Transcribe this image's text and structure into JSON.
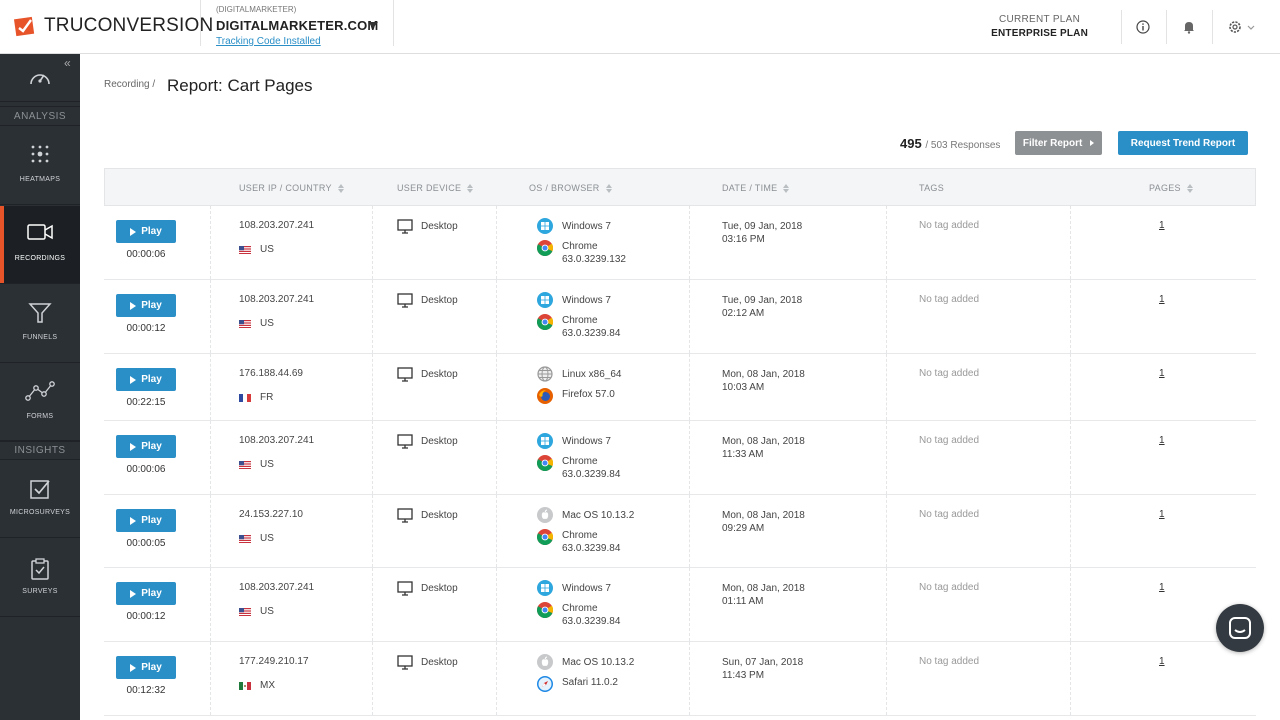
{
  "header": {
    "logo_text": "TRUCONVERSION",
    "account_small": "(DIGITALMARKETER)",
    "account_name": "DIGITALMARKETER.COM",
    "tracking_link": "Tracking Code Installed",
    "plan_label": "CURRENT PLAN",
    "plan_value": "ENTERPRISE PLAN"
  },
  "sidebar": {
    "collapse": "«",
    "section_analysis": "ANALYSIS",
    "section_insights": "INSIGHTS",
    "items": [
      {
        "label": "HEATMAPS"
      },
      {
        "label": "RECORDINGS"
      },
      {
        "label": "FUNNELS"
      },
      {
        "label": "FORMS"
      },
      {
        "label": "MICROSURVEYS"
      },
      {
        "label": "SURVEYS"
      }
    ]
  },
  "main": {
    "breadcrumb": "Recording /",
    "title": "Report: Cart Pages",
    "responses_count": "495",
    "responses_total": "/ 503 Responses",
    "filter_button": "Filter Report",
    "trend_button": "Request Trend Report"
  },
  "table": {
    "columns": [
      "USER IP / COUNTRY",
      "USER DEVICE",
      "OS / BROWSER",
      "DATE / TIME",
      "TAGS",
      "PAGES"
    ],
    "play_label": "Play",
    "rows": [
      {
        "duration": "00:00:06",
        "ip": "108.203.207.241",
        "country": "US",
        "device": "Desktop",
        "os": "Windows 7",
        "browser": "Chrome",
        "version": "63.0.3239.132",
        "date": "Tue, 09 Jan, 2018",
        "time": "03:16 PM",
        "tags": "No tag added",
        "pages": "1"
      },
      {
        "duration": "00:00:12",
        "ip": "108.203.207.241",
        "country": "US",
        "device": "Desktop",
        "os": "Windows 7",
        "browser": "Chrome",
        "version": "63.0.3239.84",
        "date": "Tue, 09 Jan, 2018",
        "time": "02:12 AM",
        "tags": "No tag added",
        "pages": "1"
      },
      {
        "duration": "00:22:15",
        "ip": "176.188.44.69",
        "country": "FR",
        "device": "Desktop",
        "os": "Linux x86_64",
        "browser": "Firefox 57.0",
        "version": "",
        "date": "Mon, 08 Jan, 2018",
        "time": "10:03 AM",
        "tags": "No tag added",
        "pages": "1"
      },
      {
        "duration": "00:00:06",
        "ip": "108.203.207.241",
        "country": "US",
        "device": "Desktop",
        "os": "Windows 7",
        "browser": "Chrome",
        "version": "63.0.3239.84",
        "date": "Mon, 08 Jan, 2018",
        "time": "11:33 AM",
        "tags": "No tag added",
        "pages": "1"
      },
      {
        "duration": "00:00:05",
        "ip": "24.153.227.10",
        "country": "US",
        "device": "Desktop",
        "os": "Mac OS 10.13.2",
        "browser": "Chrome",
        "version": "63.0.3239.84",
        "date": "Mon, 08 Jan, 2018",
        "time": "09:29 AM",
        "tags": "No tag added",
        "pages": "1"
      },
      {
        "duration": "00:00:12",
        "ip": "108.203.207.241",
        "country": "US",
        "device": "Desktop",
        "os": "Windows 7",
        "browser": "Chrome",
        "version": "63.0.3239.84",
        "date": "Mon, 08 Jan, 2018",
        "time": "01:11 AM",
        "tags": "No tag added",
        "pages": "1"
      },
      {
        "duration": "00:12:32",
        "ip": "177.249.210.17",
        "country": "MX",
        "device": "Desktop",
        "os": "Mac OS 10.13.2",
        "browser": "Safari 11.0.2",
        "version": "",
        "date": "Sun, 07 Jan, 2018",
        "time": "11:43 PM",
        "tags": "No tag added",
        "pages": "1"
      }
    ]
  },
  "colors": {
    "accent": "#2b8fc7",
    "sidebar_bg": "#2b3035",
    "active_marker": "#e8542a",
    "filter_button": "#8d9194"
  }
}
